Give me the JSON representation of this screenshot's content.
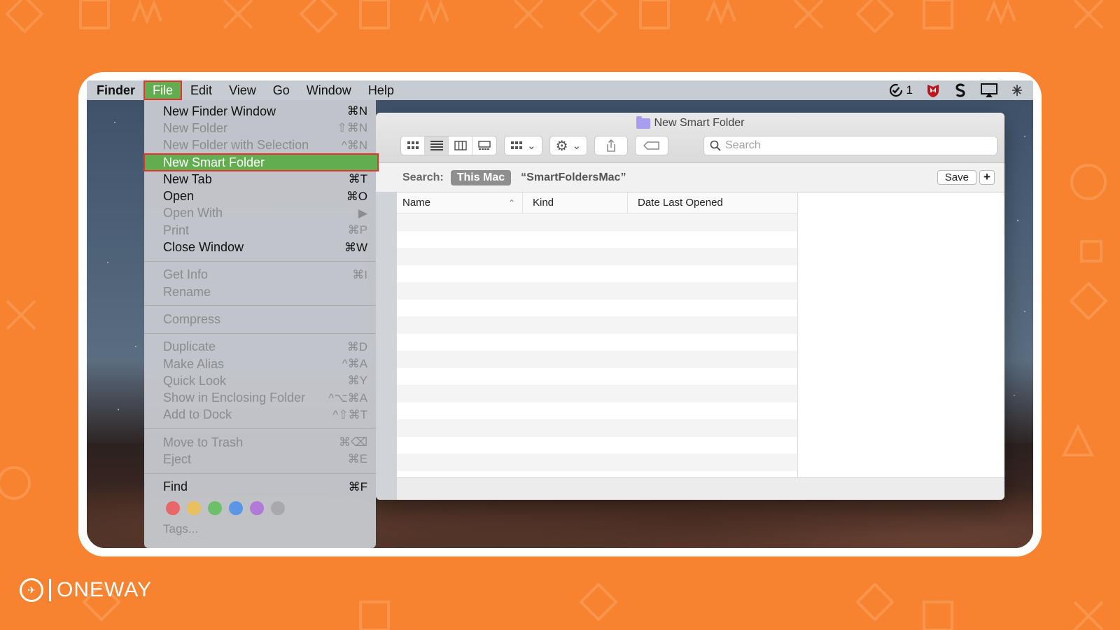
{
  "menubar": {
    "app": "Finder",
    "items": [
      "File",
      "Edit",
      "View",
      "Go",
      "Window",
      "Help"
    ],
    "status_count": "1"
  },
  "file_menu": {
    "items": [
      {
        "label": "New Finder Window",
        "shortcut": "⌘N",
        "enabled": true
      },
      {
        "label": "New Folder",
        "shortcut": "⇧⌘N",
        "enabled": false
      },
      {
        "label": "New Folder with Selection",
        "shortcut": "^⌘N",
        "enabled": false
      },
      {
        "label": "New Smart Folder",
        "shortcut": "",
        "enabled": true,
        "highlighted": true
      },
      {
        "label": "New Tab",
        "shortcut": "⌘T",
        "enabled": true
      },
      {
        "label": "Open",
        "shortcut": "⌘O",
        "enabled": true
      },
      {
        "label": "Open With",
        "shortcut": "▶",
        "enabled": false
      },
      {
        "label": "Print",
        "shortcut": "⌘P",
        "enabled": false
      },
      {
        "label": "Close Window",
        "shortcut": "⌘W",
        "enabled": true
      },
      {
        "label": "Get Info",
        "shortcut": "⌘I",
        "enabled": false
      },
      {
        "label": "Rename",
        "shortcut": "",
        "enabled": false
      },
      {
        "label": "Compress",
        "shortcut": "",
        "enabled": false
      },
      {
        "label": "Duplicate",
        "shortcut": "⌘D",
        "enabled": false
      },
      {
        "label": "Make Alias",
        "shortcut": "^⌘A",
        "enabled": false
      },
      {
        "label": "Quick Look",
        "shortcut": "⌘Y",
        "enabled": false
      },
      {
        "label": "Show in Enclosing Folder",
        "shortcut": "^⌥⌘A",
        "enabled": false
      },
      {
        "label": "Add to Dock",
        "shortcut": "^⇧⌘T",
        "enabled": false
      },
      {
        "label": "Move to Trash",
        "shortcut": "⌘⌫",
        "enabled": false
      },
      {
        "label": "Eject",
        "shortcut": "⌘E",
        "enabled": false
      },
      {
        "label": "Find",
        "shortcut": "⌘F",
        "enabled": true
      }
    ],
    "tag_colors": [
      "#e8686a",
      "#e8c15e",
      "#6cc06a",
      "#5b95e5",
      "#b07ad6",
      "#a9a9ad"
    ],
    "tags_label": "Tags..."
  },
  "window": {
    "title": "New Smart Folder",
    "search_placeholder": "Search",
    "scope_label": "Search:",
    "scope_active": "This Mac",
    "scope_query": "“SmartFoldersMac”",
    "save_label": "Save",
    "add_label": "+",
    "columns": [
      "Name",
      "Kind",
      "Date Last Opened"
    ]
  },
  "brand": {
    "name": "ONEWAY"
  }
}
